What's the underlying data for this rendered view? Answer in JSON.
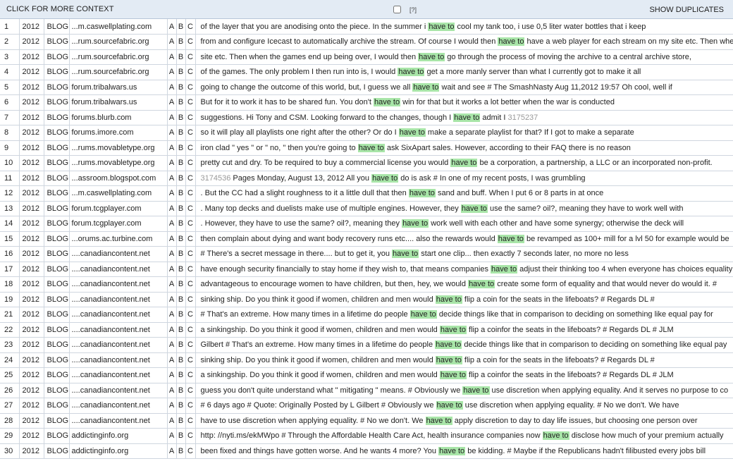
{
  "toolbar": {
    "context_label": "CLICK FOR MORE CONTEXT",
    "help_label": "[?]",
    "duplicates_label": "SHOW DUPLICATES"
  },
  "colors": {
    "header_bg": "#e3ebf4",
    "keyword_highlight": "#a8e5a8",
    "grid_line": "#cfd6df"
  },
  "keyword": "have to",
  "rows": [
    {
      "n": "1",
      "year": "2012",
      "genre": "BLOG",
      "source": "...m.caswellplating.com",
      "pre": "of the layer that you are anodising onto the piece. In the summer i ",
      "kw": "have to",
      "post": " cool my tank too, i use 0,5 liter water bottles that i keep"
    },
    {
      "n": "2",
      "year": "2012",
      "genre": "BLOG",
      "source": "...rum.sourcefabric.org",
      "pre": "from and configure Icecast to automatically archive the stream. Of course I would then ",
      "kw": "have to",
      "post": " have a web player for each stream on my site etc. Then whe"
    },
    {
      "n": "3",
      "year": "2012",
      "genre": "BLOG",
      "source": "...rum.sourcefabric.org",
      "pre": "site etc. Then when the games end up being over, I would then ",
      "kw": "have to",
      "post": " go through the process of moving the archive to a central archive store,"
    },
    {
      "n": "4",
      "year": "2012",
      "genre": "BLOG",
      "source": "...rum.sourcefabric.org",
      "pre": "of the games. The only problem I then run into is, I would ",
      "kw": "have to",
      "post": " get a more manly server than what I currently got to make it all"
    },
    {
      "n": "5",
      "year": "2012",
      "genre": "BLOG",
      "source": "forum.tribalwars.us",
      "pre": "going to change the outcome of this world, but, I guess we all ",
      "kw": "have to",
      "post": " wait and see # The SmashNasty Aug 11,2012 19:57 Oh cool, well if"
    },
    {
      "n": "6",
      "year": "2012",
      "genre": "BLOG",
      "source": "forum.tribalwars.us",
      "pre": "But for it to work it has to be shared fun. You don't ",
      "kw": "have to",
      "post": " win for that but it works a lot better when the war is conducted"
    },
    {
      "n": "7",
      "year": "2012",
      "genre": "BLOG",
      "source": "forums.blurb.com",
      "pre": "suggestions. Hi Tony and CSM. Looking forward to the changes, though I ",
      "kw": "have to",
      "post": " admit I ",
      "ref": "3175237"
    },
    {
      "n": "8",
      "year": "2012",
      "genre": "BLOG",
      "source": "forums.imore.com",
      "pre": "so it will play all playlists one right after the other? Or do I ",
      "kw": "have to",
      "post": " make a separate playlist for that? If I got to make a separate"
    },
    {
      "n": "9",
      "year": "2012",
      "genre": "BLOG",
      "source": "...rums.movabletype.org",
      "pre": "iron clad \" yes \" or \" no, \" then you're going to ",
      "kw": "have to",
      "post": " ask SixApart sales. However, according to their FAQ there is no reason"
    },
    {
      "n": "10",
      "year": "2012",
      "genre": "BLOG",
      "source": "...rums.movabletype.org",
      "pre": "pretty cut and dry. To be required to buy a commercial license you would ",
      "kw": "have to",
      "post": " be a corporation, a partnership, a LLC or an incorporated non-profit."
    },
    {
      "n": "11",
      "year": "2012",
      "genre": "BLOG",
      "source": "...assroom.blogspot.com",
      "lead": "3174536",
      "pre": " Pages Monday, August 13, 2012 All you ",
      "kw": "have to",
      "post": " do is ask # In one of my recent posts, I was grumbling"
    },
    {
      "n": "12",
      "year": "2012",
      "genre": "BLOG",
      "source": "...m.caswellplating.com",
      "pre": ". But the CC had a slight roughness to it a little dull that then ",
      "kw": "have to",
      "post": " sand and buff. When I put 6 or 8 parts in at once"
    },
    {
      "n": "13",
      "year": "2012",
      "genre": "BLOG",
      "source": "forum.tcgplayer.com",
      "pre": ". Many top decks and duelists make use of multiple engines. However, they ",
      "kw": "have to",
      "post": " use the same? oil?, meaning they have to work well with"
    },
    {
      "n": "14",
      "year": "2012",
      "genre": "BLOG",
      "source": "forum.tcgplayer.com",
      "pre": ". However, they have to use the same? oil?, meaning they ",
      "kw": "have to",
      "post": " work well with each other and have some synergy; otherwise the deck will"
    },
    {
      "n": "15",
      "year": "2012",
      "genre": "BLOG",
      "source": "...orums.ac.turbine.com",
      "pre": "then complain about dying and want body recovery runs etc.... also the rewards would ",
      "kw": "have to",
      "post": " be revamped as 100+ mill for a lvl 50 for example would be"
    },
    {
      "n": "16",
      "year": "2012",
      "genre": "BLOG",
      "source": "....canadiancontent.net",
      "pre": "# There's a secret message in there.... but to get it, you ",
      "kw": "have to",
      "post": " start one clip... then exactly 7 seconds later, no more no less"
    },
    {
      "n": "17",
      "year": "2012",
      "genre": "BLOG",
      "source": "....canadiancontent.net",
      "pre": "have enough security financially to stay home if they wish to, that means companies ",
      "kw": "have to",
      "post": " adjust their thinking too 4 when everyone has choices equality"
    },
    {
      "n": "18",
      "year": "2012",
      "genre": "BLOG",
      "source": "....canadiancontent.net",
      "pre": "advantageous to encourage women to have children, but then, hey, we would ",
      "kw": "have to",
      "post": " create some form of equality and that would never do would it. #"
    },
    {
      "n": "19",
      "year": "2012",
      "genre": "BLOG",
      "source": "....canadiancontent.net",
      "pre": "sinking ship. Do you think it good if women, children and men would ",
      "kw": "have to",
      "post": " flip a coin for the seats in the lifeboats? # Regards DL #"
    },
    {
      "n": "21",
      "year": "2012",
      "genre": "BLOG",
      "source": "....canadiancontent.net",
      "pre": "# That's an extreme. How many times in a lifetime do people ",
      "kw": "have to",
      "post": " decide things like that in comparison to deciding on something like equal pay for"
    },
    {
      "n": "22",
      "year": "2012",
      "genre": "BLOG",
      "source": "....canadiancontent.net",
      "pre": "a sinkingship. Do you think it good if women, children and men would ",
      "kw": "have to",
      "post": " flip a coinfor the seats in the lifeboats? # Regards DL # JLM"
    },
    {
      "n": "23",
      "year": "2012",
      "genre": "BLOG",
      "source": "....canadiancontent.net",
      "pre": "Gilbert # That's an extreme. How many times in a lifetime do people ",
      "kw": "have to",
      "post": " decide things like that in comparison to deciding on something like equal pay"
    },
    {
      "n": "24",
      "year": "2012",
      "genre": "BLOG",
      "source": "....canadiancontent.net",
      "pre": "sinking ship. Do you think it good if women, children and men would ",
      "kw": "have to",
      "post": " flip a coin for the seats in the lifeboats? # Regards DL #"
    },
    {
      "n": "25",
      "year": "2012",
      "genre": "BLOG",
      "source": "....canadiancontent.net",
      "pre": "a sinkingship. Do you think it good if women, children and men would ",
      "kw": "have to",
      "post": " flip a coinfor the seats in the lifeboats? # Regards DL # JLM"
    },
    {
      "n": "26",
      "year": "2012",
      "genre": "BLOG",
      "source": "....canadiancontent.net",
      "pre": "guess you don't quite understand what \" mitigating \" means. # Obviously we ",
      "kw": "have to",
      "post": " use discretion when applying equality. And it serves no purpose to co"
    },
    {
      "n": "27",
      "year": "2012",
      "genre": "BLOG",
      "source": "....canadiancontent.net",
      "pre": "# 6 days ago # Quote: Originally Posted by L Gilbert # Obviously we ",
      "kw": "have to",
      "post": " use discretion when applying equality. # No we don't. We have"
    },
    {
      "n": "28",
      "year": "2012",
      "genre": "BLOG",
      "source": "....canadiancontent.net",
      "pre": "have to use discretion when applying equality. # No we don't. We ",
      "kw": "have to",
      "post": " apply discretion to day to day life issues, but choosing one person over"
    },
    {
      "n": "29",
      "year": "2012",
      "genre": "BLOG",
      "source": "addictinginfo.org",
      "pre": "http: //nyti.ms/ekMWpo # Through the Affordable Health Care Act, health insurance companies now ",
      "kw": "have to",
      "post": " disclose how much of your premium actually"
    },
    {
      "n": "30",
      "year": "2012",
      "genre": "BLOG",
      "source": "addictinginfo.org",
      "pre": "been fixed and things have gotten worse. And he wants 4 more? You ",
      "kw": "have to",
      "post": " be kidding. # Maybe if the Republicans hadn't filibusted every jobs bill"
    }
  ]
}
